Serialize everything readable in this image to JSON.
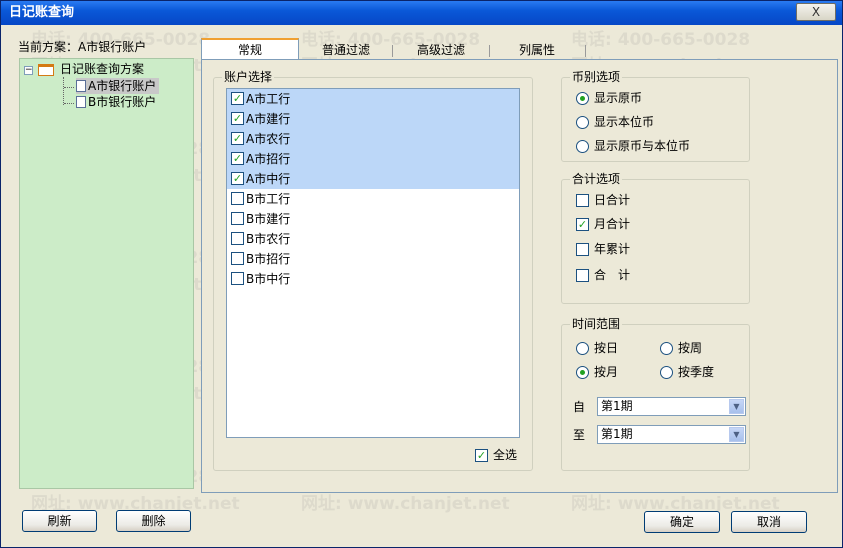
{
  "window": {
    "title": "日记账查询",
    "close_label": "X"
  },
  "watermarks": [
    "电话: 400-665-0028",
    "网址: www.chanjet.net"
  ],
  "scheme": {
    "label": "当前方案：A市银行账户",
    "tree": {
      "root": "日记账查询方案",
      "children": [
        "A市银行账户",
        "B市银行账户"
      ]
    }
  },
  "tabs": [
    "常规",
    "普通过滤",
    "高级过滤",
    "列属性"
  ],
  "accounts": {
    "title": "账户选择",
    "items": [
      {
        "label": "A市工行",
        "checked": true
      },
      {
        "label": "A市建行",
        "checked": true
      },
      {
        "label": "A市农行",
        "checked": true
      },
      {
        "label": "A市招行",
        "checked": true
      },
      {
        "label": "A市中行",
        "checked": true
      },
      {
        "label": "B市工行",
        "checked": false
      },
      {
        "label": "B市建行",
        "checked": false
      },
      {
        "label": "B市农行",
        "checked": false
      },
      {
        "label": "B市招行",
        "checked": false
      },
      {
        "label": "B市中行",
        "checked": false
      }
    ],
    "select_all_label": "全选"
  },
  "currency": {
    "title": "币别选项",
    "options": [
      "显示原币",
      "显示本位币",
      "显示原币与本位币"
    ]
  },
  "totals": {
    "title": "合计选项",
    "options": [
      "日合计",
      "月合计",
      "年累计",
      "合　计"
    ]
  },
  "time_range": {
    "title": "时间范围",
    "options": [
      "按日",
      "按周",
      "按月",
      "按季度"
    ],
    "from_label": "自",
    "from_value": "第1期",
    "to_label": "至",
    "to_value": "第1期"
  },
  "buttons": {
    "refresh": "刷新",
    "delete": "删除",
    "ok": "确定",
    "cancel": "取消"
  },
  "icons": {
    "check": "✓",
    "dropdown": "▼",
    "collapse": "−"
  }
}
